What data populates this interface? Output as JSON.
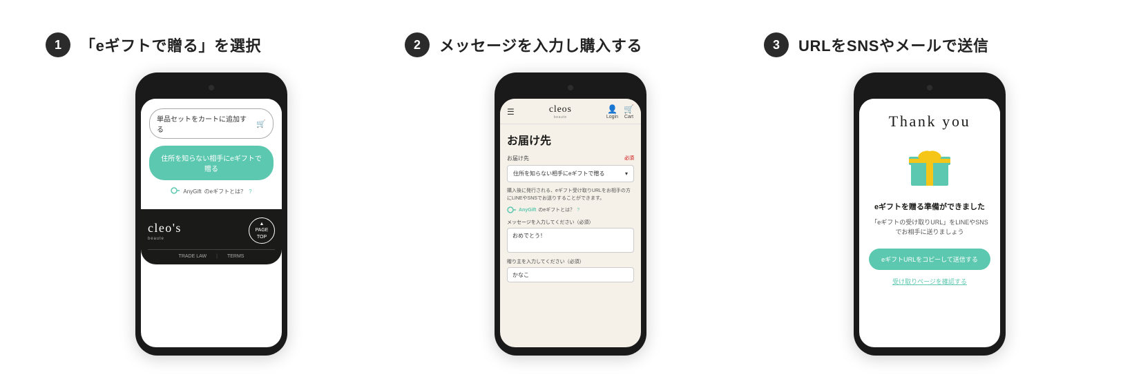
{
  "steps": [
    {
      "number": "1",
      "title": "「eギフトで贈る」を選択"
    },
    {
      "number": "2",
      "title": "メッセージを入力し購入する"
    },
    {
      "number": "3",
      "title": "URLをSNSやメールで送信"
    }
  ],
  "phone1": {
    "cart_button": "単品セットをカートに追加する",
    "gift_button": "住所を知らない相手にeギフトで贈る",
    "anygift_label": "AnyGift",
    "anygift_link": "のeギフトとは？",
    "brand_name": "cleo's",
    "brand_sub": "beaute",
    "page_top_arrow": "▲",
    "page_top_label": "PAGE\nTOP",
    "footer_trade": "TRADE LAW",
    "footer_terms": "TERMS"
  },
  "phone2": {
    "logo": "cleos",
    "logo_sub": "beaute",
    "login_label": "Login",
    "cart_label": "Cart",
    "page_title": "お届け先",
    "field_label": "お届け先",
    "required": "必須",
    "select_value": "住所を知らない相手にeギフトで贈る",
    "desc_text": "購入後に発行される、eギフト受け取りURLをお相手の方にLINEやSNSでお送りすることができます。",
    "anygift_label": "AnyGift",
    "anygift_link": "のeギフトとは？",
    "message_label": "メッセージを入力してください（必須）",
    "message_value": "おめでとう！",
    "sender_label": "贈り主を入力してください（必須）",
    "sender_value": "かなこ"
  },
  "phone3": {
    "thank_you": "Thank you",
    "ready_text": "eギフトを贈る準備ができました",
    "desc_text": "「eギフトの受け取りURL」をLINEやSNSでお相手に送りましょう",
    "copy_button": "eギフトURLをコピーして送信する",
    "view_link": "受け取りページを確認する"
  }
}
